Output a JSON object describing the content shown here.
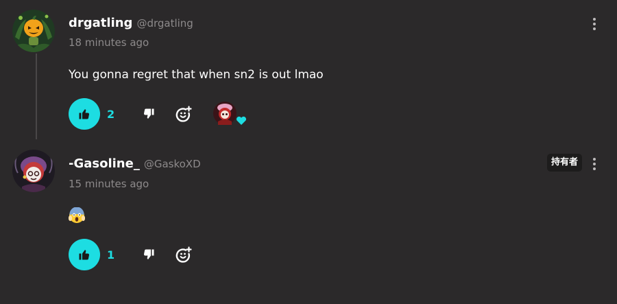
{
  "comments": [
    {
      "username": "drgatling",
      "handle": "@drgatling",
      "timestamp": "18 minutes ago",
      "text": "You gonna regret that when sn2 is out lmao",
      "likes": "2",
      "avatar_icon": "pumpkin-character-avatar",
      "creator_heart": true
    },
    {
      "username": "-Gasoline_",
      "handle": "@GaskoXD",
      "timestamp": "15 minutes ago",
      "text_emoji": "face-screaming-in-fear",
      "owner_badge": "持有者",
      "likes": "1",
      "avatar_icon": "masked-character-avatar"
    }
  ],
  "colors": {
    "background": "#2b292a",
    "accent": "#1ddde2",
    "muted_text": "#8d8a8b"
  }
}
